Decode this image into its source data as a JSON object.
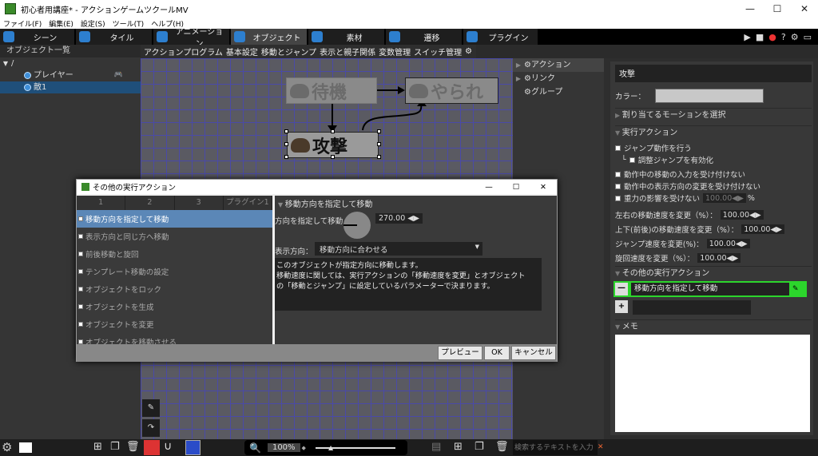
{
  "window": {
    "title": "初心者用講座* - アクションゲームツクールMV",
    "controls": [
      "—",
      "☐",
      "✕"
    ]
  },
  "menu": [
    "ファイル(F)",
    "編集(E)",
    "設定(S)",
    "ツール(T)",
    "ヘルプ(H)"
  ],
  "main_tabs": [
    {
      "label": "シーン"
    },
    {
      "label": "タイル"
    },
    {
      "label": "アニメーション"
    },
    {
      "label": "オブジェクト"
    },
    {
      "label": "素材"
    },
    {
      "label": "遷移"
    },
    {
      "label": "プラグイン"
    }
  ],
  "object_list": {
    "header": "オブジェクト一覧",
    "root": "/",
    "items": [
      {
        "label": "プレイヤー"
      },
      {
        "label": "敵1"
      }
    ]
  },
  "sub_tabs": [
    "アクションプログラム",
    "基本設定",
    "移動とジャンプ",
    "表示と親子関係",
    "変数管理",
    "スイッチ管理"
  ],
  "nodes": {
    "idle": "待機",
    "defeated": "やられ",
    "attack": "攻撃"
  },
  "action_list": [
    {
      "label": "アクション"
    },
    {
      "label": "リンク"
    },
    {
      "label": "グループ"
    }
  ],
  "props": {
    "title": "攻撃",
    "color_label": "カラー：",
    "assign_motion": "割り当てるモーションを選択",
    "exec_action_header": "実行アクション",
    "jump": "ジャンプ動作を行う",
    "adjust_jump": "調整ジャンプを有効化",
    "no_move_input": "動作中の移動の入力を受け付けない",
    "no_dir_change": "動作中の表示方向の変更を受け付けない",
    "no_gravity": "重力の影響を受けない",
    "gravity_val": "100.00",
    "percent": "%",
    "lr_speed": "左右の移動速度を変更（%）：",
    "lr_speed_val": "100.00",
    "ud_speed": "上下(前後)の移動速度を変更（%）：",
    "ud_speed_val": "100.00",
    "jump_speed": "ジャンプ速度を変更(%)：",
    "jump_speed_val": "100.00",
    "rot_speed": "旋回速度を変更（%）：",
    "rot_speed_val": "100.00",
    "other_exec_header": "その他の実行アクション",
    "other_item": "移動方向を指定して移動",
    "memo_header": "メモ"
  },
  "bottom": {
    "zoom": "100%",
    "search_placeholder": "検索するテキストを入力"
  },
  "dialog": {
    "title": "その他の実行アクション",
    "tabs": [
      "1",
      "2",
      "3",
      "プラグイン1"
    ],
    "items": [
      {
        "label": "移動方向を指定して移動",
        "checked": true
      },
      {
        "label": "表示方向と同じ方へ移動"
      },
      {
        "label": "前後移動と旋回"
      },
      {
        "label": "テンプレート移動の設定"
      },
      {
        "label": "オブジェクトをロック"
      },
      {
        "label": "オブジェクトを生成"
      },
      {
        "label": "オブジェクトを変更"
      },
      {
        "label": "オブジェクトを移動させる"
      }
    ],
    "section": "移動方向を指定して移動",
    "dir_label": "方向を指定して移動",
    "dir_value": "270.00",
    "disp_label": "表示方向：",
    "disp_value": "移動方向に合わせる",
    "desc1": "このオブジェクトが指定方向に移動します。",
    "desc2": "移動速度に関しては、実行アクションの「移動速度を変更」とオブジェクト",
    "desc3": "の「移動とジャンプ」に設定しているパラメーターで決まります。",
    "btn_preview": "プレビュー",
    "btn_ok": "OK",
    "btn_cancel": "キャンセル"
  }
}
